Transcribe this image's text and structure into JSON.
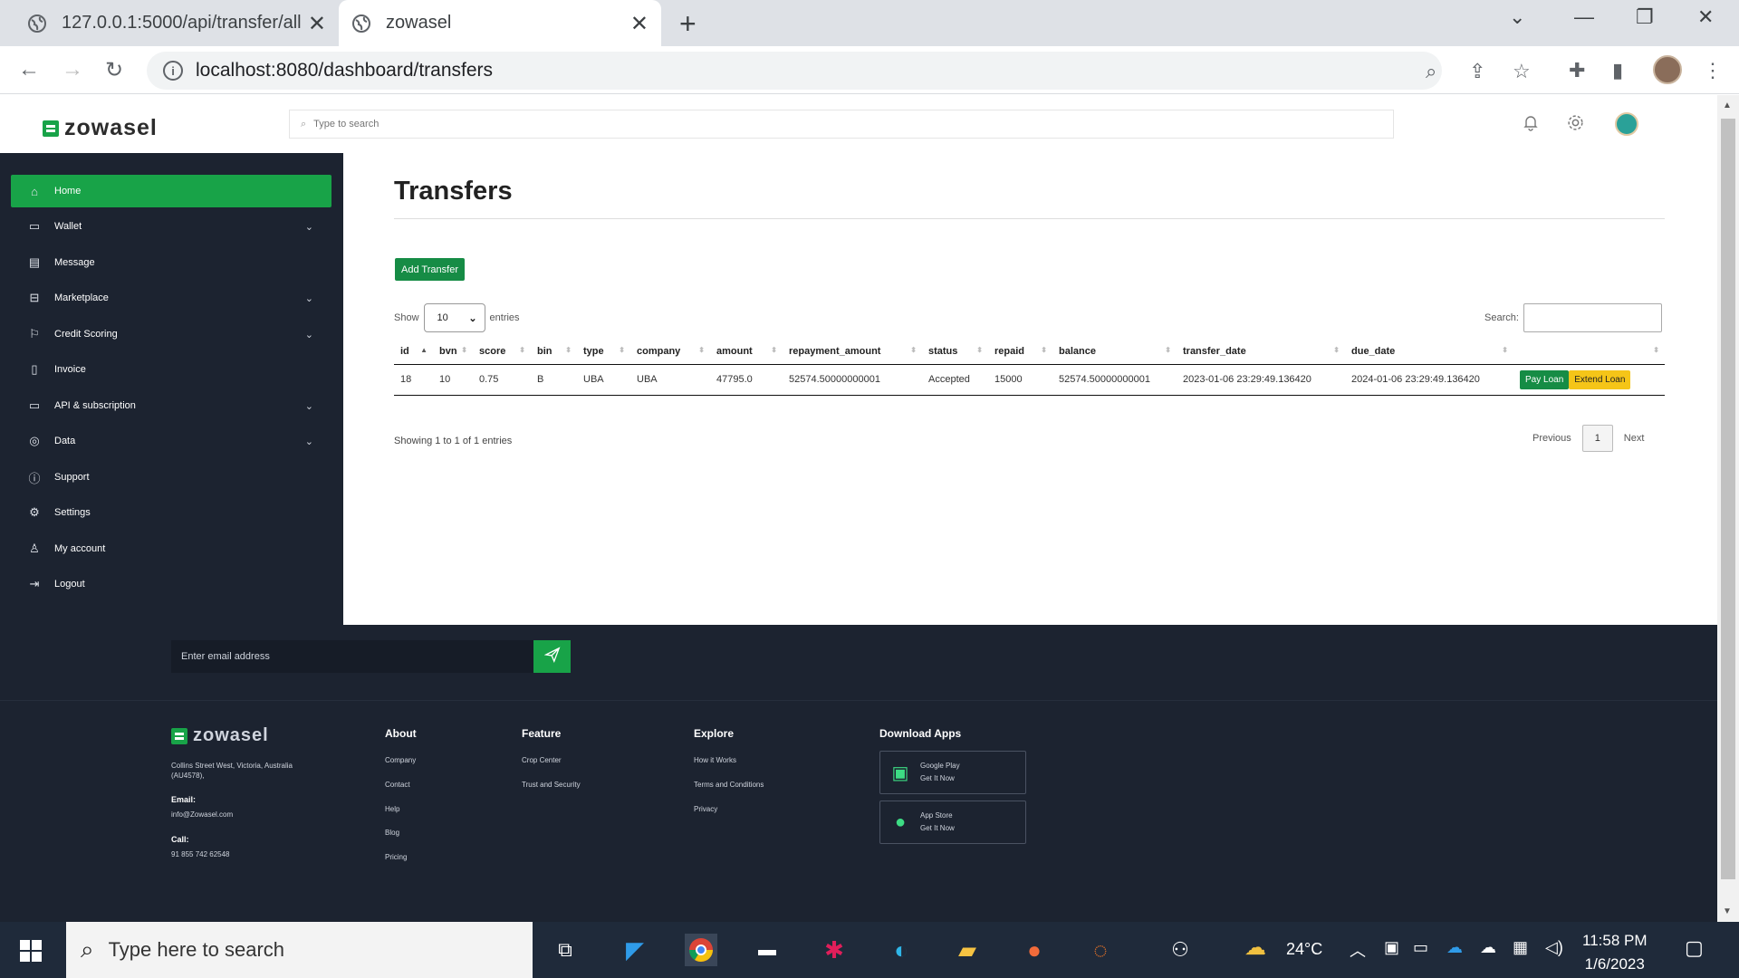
{
  "browser": {
    "tabs": [
      {
        "title": "127.0.0.1:5000/api/transfer/all"
      },
      {
        "title": "zowasel"
      }
    ],
    "url": "localhost:8080/dashboard/transfers"
  },
  "app": {
    "brand": "zowasel",
    "search_placeholder": "Type to search"
  },
  "sidebar": {
    "items": [
      {
        "label": "Home",
        "icon": "home-icon"
      },
      {
        "label": "Wallet",
        "icon": "wallet-icon"
      },
      {
        "label": "Message",
        "icon": "message-icon"
      },
      {
        "label": "Marketplace",
        "icon": "store-icon"
      },
      {
        "label": "Credit Scoring",
        "icon": "credit-icon"
      },
      {
        "label": "Invoice",
        "icon": "invoice-icon"
      },
      {
        "label": "API & subscription",
        "icon": "folder-icon"
      },
      {
        "label": "Data",
        "icon": "database-icon"
      },
      {
        "label": "Support",
        "icon": "info-icon"
      },
      {
        "label": "Settings",
        "icon": "gear-icon"
      },
      {
        "label": "My account",
        "icon": "user-icon"
      },
      {
        "label": "Logout",
        "icon": "logout-icon"
      }
    ]
  },
  "main": {
    "title": "Transfers",
    "add_button": "Add Transfer",
    "show_label": "Show",
    "entries_value": "10",
    "entries_label": "entries",
    "search_label": "Search:",
    "columns": [
      "id",
      "bvn",
      "score",
      "bin",
      "type",
      "company",
      "amount",
      "repayment_amount",
      "status",
      "repaid",
      "balance",
      "transfer_date",
      "due_date",
      ""
    ],
    "rows": [
      {
        "id": "18",
        "bvn": "10",
        "score": "0.75",
        "bin": "B",
        "type": "UBA",
        "company": "UBA",
        "amount": "47795.0",
        "repayment_amount": "52574.50000000001",
        "status": "Accepted",
        "repaid": "15000",
        "balance": "52574.50000000001",
        "transfer_date": "2023-01-06 23:29:49.136420",
        "due_date": "2024-01-06 23:29:49.136420",
        "pay_label": "Pay Loan",
        "extend_label": "Extend Loan"
      }
    ],
    "info": "Showing 1 to 1 of 1 entries",
    "pager": {
      "previous": "Previous",
      "page": "1",
      "next": "Next"
    }
  },
  "footer": {
    "email_placeholder": "Enter email address",
    "brand": "zowasel",
    "address": "Collins Street West, Victoria, Australia (AU4578),",
    "email_label": "Email:",
    "email": "info@Zowasel.com",
    "call_label": "Call:",
    "phone": "91 855 742 62548",
    "about": {
      "title": "About",
      "links": [
        "Company",
        "Contact",
        "Help",
        "Blog",
        "Pricing"
      ]
    },
    "feature": {
      "title": "Feature",
      "links": [
        "Crop Center",
        "Trust and Security"
      ]
    },
    "explore": {
      "title": "Explore",
      "links": [
        "How it Works",
        "Terms and Conditions",
        "Privacy"
      ]
    },
    "download": {
      "title": "Download Apps",
      "apps": [
        {
          "line1": "Google Play",
          "line2": "Get It Now"
        },
        {
          "line1": "App Store",
          "line2": "Get It Now"
        }
      ]
    }
  },
  "taskbar": {
    "search_placeholder": "Type here to search",
    "temperature": "24°C",
    "time": "11:58 PM",
    "date": "1/6/2023"
  }
}
